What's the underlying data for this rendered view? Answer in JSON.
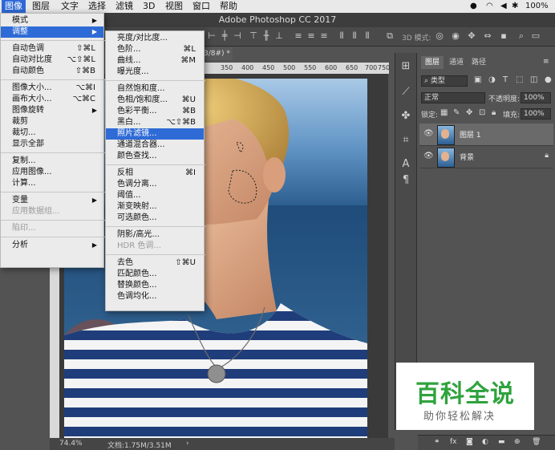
{
  "menubar": {
    "items": [
      "图像",
      "图层",
      "文字",
      "选择",
      "滤镜",
      "3D",
      "视图",
      "窗口",
      "帮助"
    ],
    "battery": "100%"
  },
  "window": {
    "title": "Adobe Photoshop CC 2017",
    "doc_tab": "3/8#) *"
  },
  "ruler": {
    "labels": [
      "350",
      "400",
      "450",
      "500",
      "550",
      "600",
      "650",
      "700",
      "750"
    ]
  },
  "image_menu": {
    "items": [
      {
        "label": "模式",
        "shortcut": "",
        "arrow": true
      },
      {
        "label": "调整",
        "shortcut": "",
        "arrow": true,
        "highlight": true
      },
      {
        "sep": true
      },
      {
        "label": "自动色调",
        "shortcut": "⇧⌘L"
      },
      {
        "label": "自动对比度",
        "shortcut": "⌥⇧⌘L"
      },
      {
        "label": "自动颜色",
        "shortcut": "⇧⌘B"
      },
      {
        "sep": true
      },
      {
        "label": "图像大小...",
        "shortcut": "⌥⌘I"
      },
      {
        "label": "画布大小...",
        "shortcut": "⌥⌘C"
      },
      {
        "label": "图像旋转",
        "shortcut": "",
        "arrow": true
      },
      {
        "label": "裁剪",
        "shortcut": ""
      },
      {
        "label": "裁切...",
        "shortcut": ""
      },
      {
        "label": "显示全部",
        "shortcut": ""
      },
      {
        "sep": true
      },
      {
        "label": "复制...",
        "shortcut": ""
      },
      {
        "label": "应用图像...",
        "shortcut": ""
      },
      {
        "label": "计算...",
        "shortcut": ""
      },
      {
        "sep": true
      },
      {
        "label": "变量",
        "shortcut": "",
        "arrow": true
      },
      {
        "label": "应用数据组...",
        "shortcut": "",
        "disabled": true
      },
      {
        "sep": true
      },
      {
        "label": "陷印...",
        "shortcut": "",
        "disabled": true
      },
      {
        "sep": true
      },
      {
        "label": "分析",
        "shortcut": "",
        "arrow": true
      }
    ]
  },
  "adjust_menu": {
    "items": [
      {
        "label": "亮度/对比度...",
        "shortcut": ""
      },
      {
        "label": "色阶...",
        "shortcut": "⌘L"
      },
      {
        "label": "曲线...",
        "shortcut": "⌘M"
      },
      {
        "label": "曝光度...",
        "shortcut": ""
      },
      {
        "sep": true
      },
      {
        "label": "自然饱和度...",
        "shortcut": ""
      },
      {
        "label": "色相/饱和度...",
        "shortcut": "⌘U"
      },
      {
        "label": "色彩平衡...",
        "shortcut": "⌘B"
      },
      {
        "label": "黑白...",
        "shortcut": "⌥⇧⌘B"
      },
      {
        "label": "照片滤镜...",
        "shortcut": "",
        "highlight": true
      },
      {
        "label": "通道混合器...",
        "shortcut": ""
      },
      {
        "label": "颜色查找...",
        "shortcut": ""
      },
      {
        "sep": true
      },
      {
        "label": "反相",
        "shortcut": "⌘I"
      },
      {
        "label": "色调分离...",
        "shortcut": ""
      },
      {
        "label": "阈值...",
        "shortcut": ""
      },
      {
        "label": "渐变映射...",
        "shortcut": ""
      },
      {
        "label": "可选颜色...",
        "shortcut": ""
      },
      {
        "sep": true
      },
      {
        "label": "阴影/高光...",
        "shortcut": ""
      },
      {
        "label": "HDR 色调...",
        "shortcut": "",
        "disabled": true
      },
      {
        "sep": true
      },
      {
        "label": "去色",
        "shortcut": "⇧⌘U"
      },
      {
        "label": "匹配颜色...",
        "shortcut": ""
      },
      {
        "label": "替换颜色...",
        "shortcut": ""
      },
      {
        "label": "色调均化...",
        "shortcut": ""
      }
    ]
  },
  "layers_panel": {
    "tabs": [
      "图层",
      "通道",
      "路径"
    ],
    "filter_kind": "类型",
    "blend_mode": "正常",
    "opacity_label": "不透明度:",
    "opacity": "100%",
    "lock_label": "锁定:",
    "fill_label": "填充:",
    "fill": "100%",
    "layers": [
      {
        "name": "图层 1",
        "active": true,
        "locked": false
      },
      {
        "name": "背景",
        "active": false,
        "locked": true
      }
    ],
    "footer_fx": "fx"
  },
  "options_bar": {
    "mode_label": "3D 模式:"
  },
  "status": {
    "zoom": "74.4%",
    "doc": "文档:1.75M/3.51M"
  },
  "watermark": {
    "title": "百科全说",
    "subtitle": "助你轻松解决"
  },
  "colors": {
    "menu_highlight": "#2f6bd6",
    "watermark_green": "#2fa33d"
  }
}
